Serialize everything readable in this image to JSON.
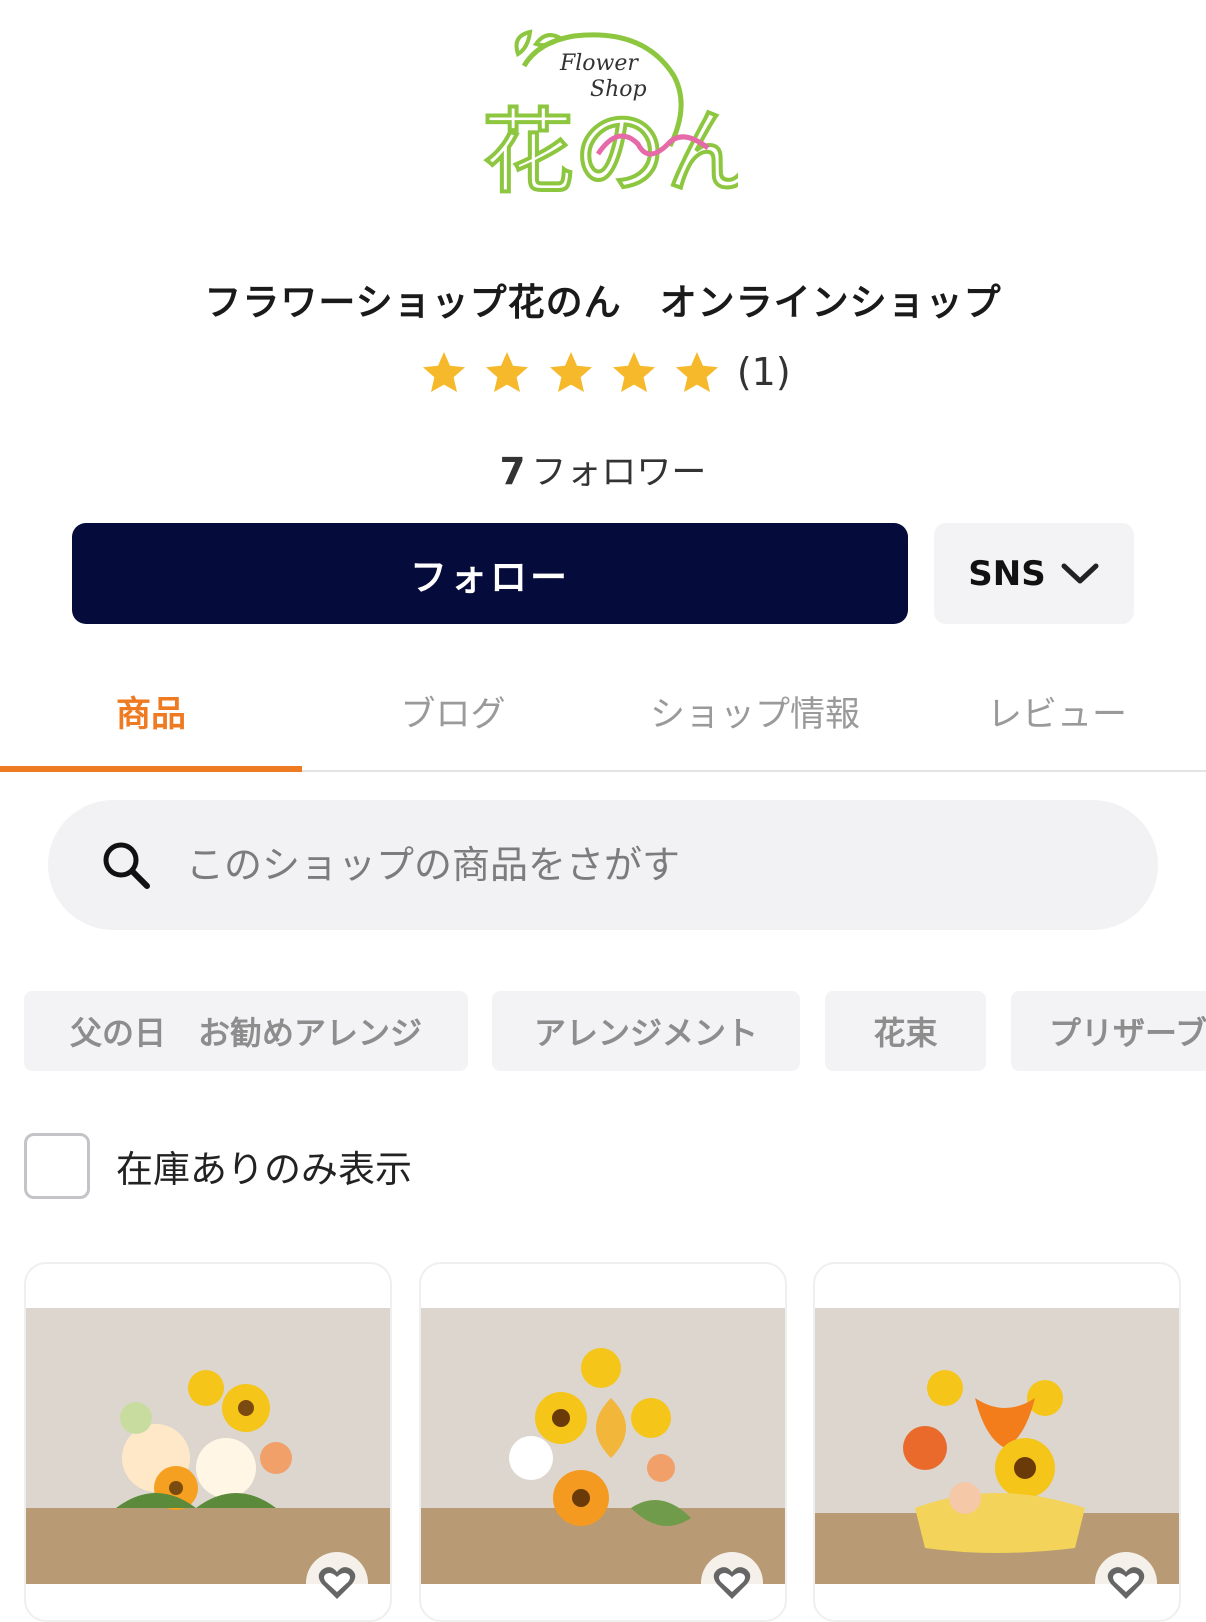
{
  "logo": {
    "line1": "Flower",
    "line2": "Shop",
    "name": "花のん"
  },
  "shop": {
    "title": "フラワーショップ花のん　オンラインショップ",
    "rating_stars": 5,
    "review_count": "(1)",
    "follower_count": "7",
    "follower_label": "フォロワー"
  },
  "actions": {
    "follow_label": "フォロー",
    "sns_label": "SNS"
  },
  "tabs": [
    {
      "label": "商品",
      "active": true
    },
    {
      "label": "ブログ",
      "active": false
    },
    {
      "label": "ショップ情報",
      "active": false
    },
    {
      "label": "レビュー",
      "active": false
    }
  ],
  "search": {
    "placeholder": "このショップの商品をさがす",
    "value": ""
  },
  "chips": [
    "父の日　お勧めアレンジ",
    "アレンジメント",
    "花束",
    "プリザーブ"
  ],
  "filter": {
    "in_stock_label": "在庫ありのみ表示",
    "checked": false
  },
  "products": [
    {
      "icon": "heart-icon"
    },
    {
      "icon": "heart-icon"
    },
    {
      "icon": "heart-icon"
    }
  ],
  "colors": {
    "accent": "#ee7a22",
    "navy": "#050b3a",
    "star": "#f5b92b",
    "logo_green": "#8dc63f",
    "logo_pink": "#e66aa8"
  }
}
